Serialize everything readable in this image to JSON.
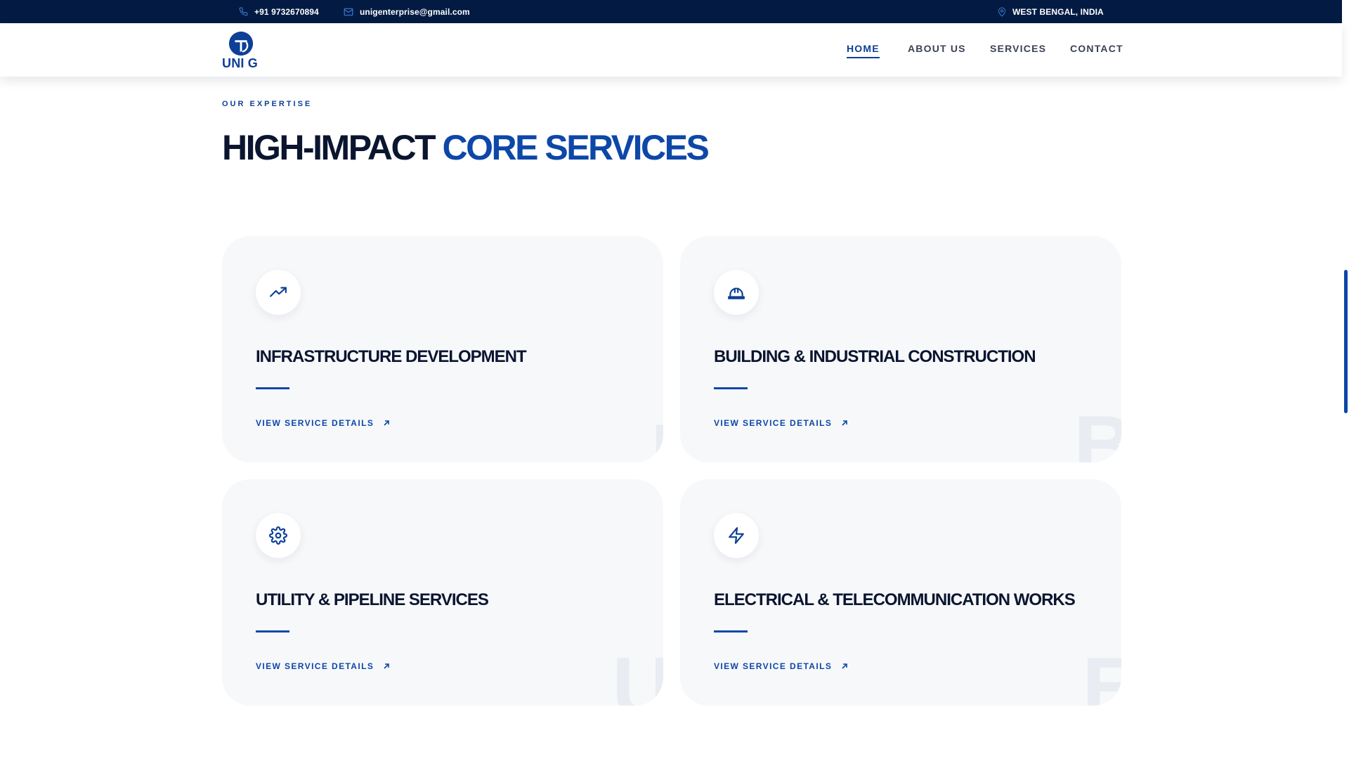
{
  "topbar": {
    "phone": "+91 9732670894",
    "email": "unigenterprise@gmail.com",
    "location": "WEST BENGAL, INDIA",
    "phone_icon": "phone-icon",
    "email_icon": "mail-icon",
    "location_icon": "map-pin-icon"
  },
  "brand": {
    "name": "UNI G",
    "logo_icon": "uni-g-logo-mark"
  },
  "nav": {
    "items": [
      {
        "label": "HOME",
        "active": true
      },
      {
        "label": "ABOUT US",
        "active": false
      },
      {
        "label": "SERVICES",
        "active": false
      },
      {
        "label": "CONTACT",
        "active": false
      }
    ]
  },
  "section": {
    "eyebrow": "OUR EXPERTISE",
    "headline_part1": "HIGH-IMPACT",
    "headline_part2": "CORE SERVICES"
  },
  "services": [
    {
      "title": "INFRASTRUCTURE DEVELOPMENT",
      "link": "VIEW SERVICE DETAILS",
      "icon": "trending-up-icon"
    },
    {
      "title": "BUILDING & INDUSTRIAL CONSTRUCTION",
      "link": "VIEW SERVICE DETAILS",
      "icon": "hard-hat-icon"
    },
    {
      "title": "UTILITY & PIPELINE SERVICES",
      "link": "VIEW SERVICE DETAILS",
      "icon": "gear-icon"
    },
    {
      "title": "ELECTRICAL & TELECOMMUNICATION WORKS",
      "link": "VIEW SERVICE DETAILS",
      "icon": "lightning-bolt-icon"
    }
  ],
  "colors": {
    "topbar_bg": "#031b43",
    "brand_blue": "#0d47a8",
    "heading_dark": "#0b1530",
    "card_bg": "#f7f8fa"
  }
}
